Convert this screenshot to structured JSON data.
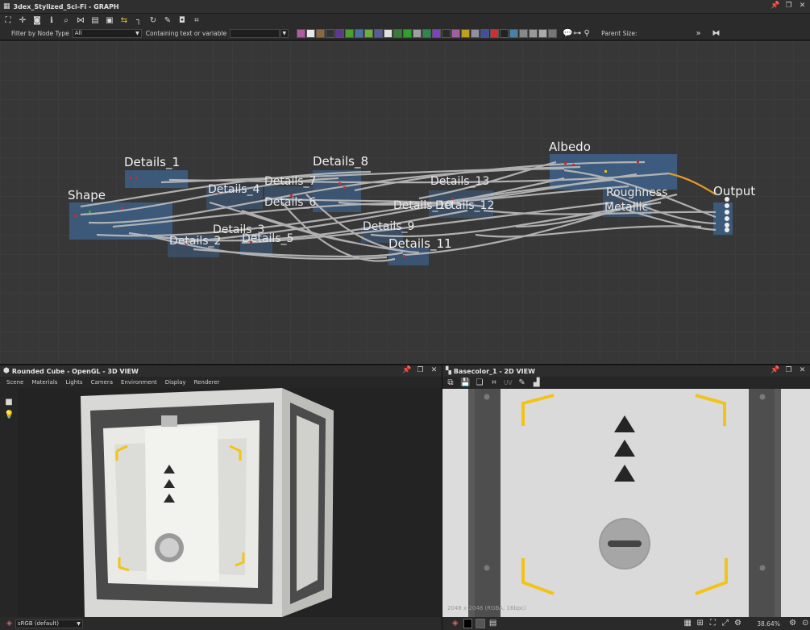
{
  "graph_window": {
    "title": "3dex_Stylized_Sci-Fi - GRAPH",
    "filter_label": "Filter by Node Type",
    "filter_value": "All",
    "containing_label": "Containing text or variable",
    "containing_value": "",
    "parent_size_label": "Parent Size:",
    "node_frames": [
      "Details_1",
      "Shape",
      "Details_4",
      "Details_7",
      "Details_6",
      "Details_8",
      "Details_3",
      "Details_5",
      "Details_2",
      "Details_9",
      "Details_10",
      "Details_12",
      "Details_13",
      "Details_11",
      "Albedo",
      "Roughness",
      "Metallic",
      "Output"
    ]
  },
  "view3d": {
    "title": "Rounded Cube - OpenGL - 3D VIEW",
    "menu": [
      "Scene",
      "Materials",
      "Lights",
      "Camera",
      "Environment",
      "Display",
      "Renderer"
    ],
    "colorspace": "sRGB (default)"
  },
  "view2d": {
    "title": "Basecolor_1 - 2D VIEW",
    "uv_label": "UV",
    "info": "2048 x 2048 (RGBA, 16bpc)",
    "zoom": "38.64%"
  },
  "colors": {
    "accent_yellow": "#f3c318",
    "node_blue": "#3d5f86",
    "panel_bg": "#dcdcdc"
  }
}
